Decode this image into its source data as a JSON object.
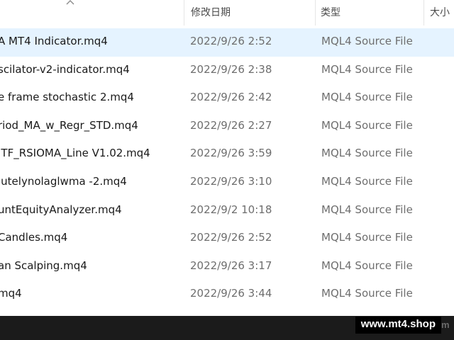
{
  "header": {
    "sort_arrow_icon": "chevron-up-icon",
    "columns": {
      "date_modified": "修改日期",
      "type": "类型",
      "size": "大小"
    }
  },
  "files": [
    {
      "name": "A MT4 Indicator.mq4",
      "date": "2022/9/26 2:52",
      "type": "MQL4 Source File",
      "selected": true
    },
    {
      "name": "scilator-v2-indicator.mq4",
      "date": "2022/9/26 2:38",
      "type": "MQL4 Source File"
    },
    {
      "name": "e frame stochastic 2.mq4",
      "date": "2022/9/26 2:42",
      "type": "MQL4 Source File"
    },
    {
      "name": "riod_MA_w_Regr_STD.mq4",
      "date": "2022/9/26 2:27",
      "type": "MQL4 Source File"
    },
    {
      "name": "ITF_RSIOMA_Line V1.02.mq4",
      "date": "2022/9/26 3:59",
      "type": "MQL4 Source File"
    },
    {
      "name": "lutelynolaglwma -2.mq4",
      "date": "2022/9/26 3:10",
      "type": "MQL4 Source File"
    },
    {
      "name": "untEquityAnalyzer.mq4",
      "date": "2022/9/2 10:18",
      "type": "MQL4 Source File"
    },
    {
      "name": "Candles.mq4",
      "date": "2022/9/26 2:52",
      "type": "MQL4 Source File"
    },
    {
      "name": "an Scalping.mq4",
      "date": "2022/9/26 3:17",
      "type": "MQL4 Source File"
    },
    {
      "name": "mq4",
      "date": "2022/9/26 3:44",
      "type": "MQL4 Source File"
    }
  ],
  "colors": {
    "selected_row": "#e5f3ff",
    "bottom_bar": "#1b1b1b"
  },
  "watermark": {
    "text": "www.mt4.shop",
    "tail": "m"
  }
}
